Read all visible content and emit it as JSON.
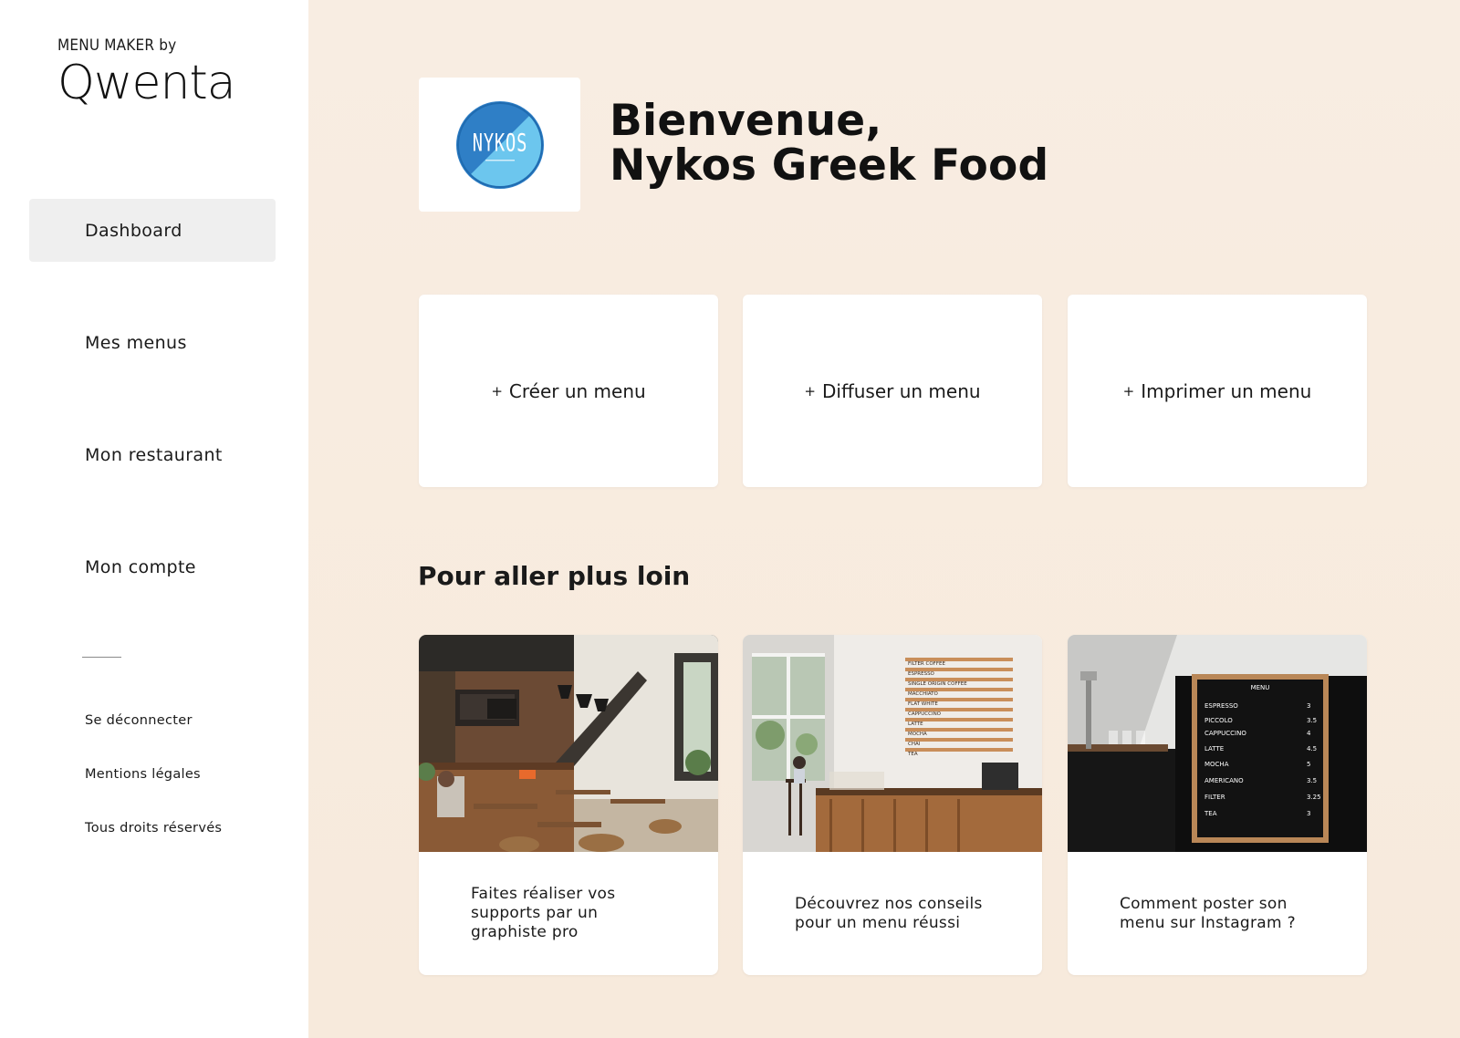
{
  "brand": {
    "tagline": "MENU MAKER by",
    "name": "Qwenta"
  },
  "sidebar": {
    "items": [
      {
        "label": "Dashboard",
        "active": true
      },
      {
        "label": "Mes menus",
        "active": false
      },
      {
        "label": "Mon restaurant",
        "active": false
      },
      {
        "label": "Mon compte",
        "active": false
      }
    ],
    "footer_links": [
      {
        "label": "Se déconnecter"
      },
      {
        "label": "Mentions légales"
      },
      {
        "label": "Tous droits réservés"
      }
    ]
  },
  "header": {
    "restaurant_logo_text": "NYKOS",
    "greeting": "Bienvenue,",
    "restaurant_name": "Nykos Greek Food"
  },
  "actions": [
    {
      "icon": "+",
      "label": "Créer un menu"
    },
    {
      "icon": "+",
      "label": "Diffuser un menu"
    },
    {
      "icon": "+",
      "label": "Imprimer un menu"
    }
  ],
  "more": {
    "title": "Pour aller plus loin",
    "articles": [
      {
        "label": "Faites réaliser vos\nsupports par un\ngraphiste pro",
        "image": "cafe-interior-photo"
      },
      {
        "label": "Découvrez nos conseils\npour un menu réussi",
        "image": "coffee-bar-menu-board-photo"
      },
      {
        "label": "Comment poster son\nmenu sur Instagram ?",
        "image": "chalkboard-menu-photo"
      }
    ],
    "menu_boards": {
      "wall_board": [
        "FILTER COFFEE",
        "ESPRESSO",
        "SINGLE ORIGIN COFFEE",
        "MACCHIATO",
        "FLAT WHITE",
        "CAPPUCCINO",
        "LATTE",
        "MOCHA",
        "CHAI",
        "TEA"
      ],
      "chalkboard_title": "MENU",
      "chalkboard_items": [
        {
          "name": "ESPRESSO",
          "price": "3"
        },
        {
          "name": "PICCOLO",
          "price": "3.5"
        },
        {
          "name": "CAPPUCCINO",
          "price": "4"
        },
        {
          "name": "LATTE",
          "price": "4.5"
        },
        {
          "name": "MOCHA",
          "price": "5"
        },
        {
          "name": "AMERICANO",
          "price": "3.5"
        },
        {
          "name": "FILTER",
          "price": "3.25"
        },
        {
          "name": "TEA",
          "price": "3"
        }
      ]
    }
  },
  "colors": {
    "page_bg": "#f7ebde",
    "sidebar_bg": "#ffffff",
    "active_item_bg": "#efefef",
    "logo_blue": "#2f7fc6",
    "logo_light_blue": "#6cc6ee"
  }
}
